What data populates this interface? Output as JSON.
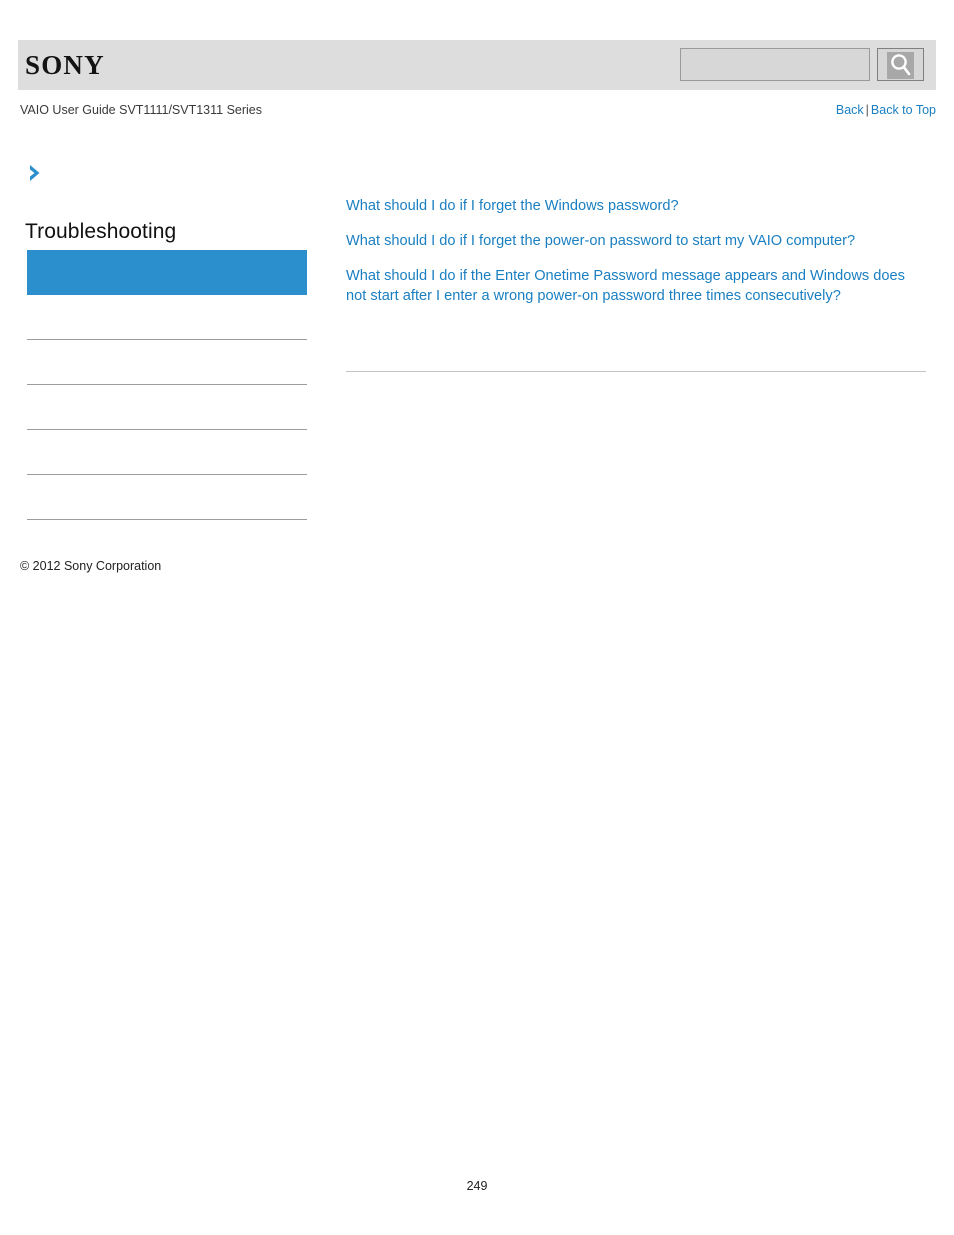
{
  "header": {
    "logo_text": "SONY",
    "logo_name": "sony-logo"
  },
  "search": {
    "value": "",
    "placeholder": "",
    "icon": "search-icon",
    "button_label": ""
  },
  "breadcrumb": {
    "text": "VAIO User Guide SVT1111/SVT1311 Series"
  },
  "nav": {
    "back_label": "Back",
    "separator": "|",
    "back_to_top_label": "Back to Top"
  },
  "sidebar": {
    "chevron_icon": "chevron-right-icon",
    "title": "Troubleshooting",
    "active_item_label": "",
    "items": [
      {
        "label": ""
      },
      {
        "label": ""
      },
      {
        "label": ""
      },
      {
        "label": ""
      },
      {
        "label": ""
      }
    ],
    "copyright": "© 2012 Sony Corporation"
  },
  "main": {
    "links": [
      {
        "text": "What should I do if I forget the Windows password?"
      },
      {
        "text": "What should I do if I forget the power-on password to start my VAIO computer?"
      },
      {
        "text": "What should I do if the Enter Onetime Password message appears and Windows does not start after I enter a wrong power-on password three times consecutively?"
      }
    ]
  },
  "footer": {
    "page_number": "249"
  },
  "colors": {
    "accent_blue": "#2b8fce",
    "link_blue": "#1a7fc1",
    "header_gray": "#dddddd",
    "divider_gray": "#9c9c9c"
  }
}
